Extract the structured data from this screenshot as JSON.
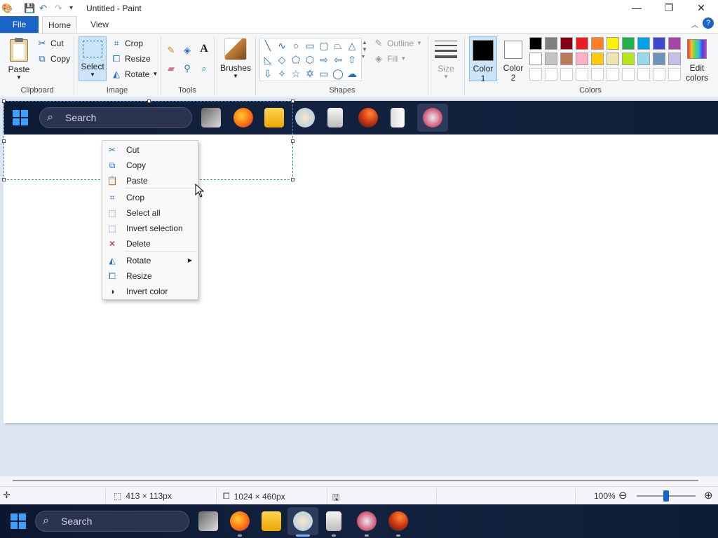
{
  "window": {
    "title": "Untitled - Paint",
    "minimize_glyph": "—",
    "maximize_glyph": "❐",
    "close_glyph": "✕"
  },
  "tabs": {
    "file": "File",
    "home": "Home",
    "view": "View",
    "help_glyph": "?",
    "collapse_glyph": "︿"
  },
  "ribbon": {
    "clipboard": {
      "label": "Clipboard",
      "paste": "Paste",
      "cut": "Cut",
      "copy": "Copy"
    },
    "image": {
      "label": "Image",
      "select": "Select",
      "crop": "Crop",
      "resize": "Resize",
      "rotate": "Rotate"
    },
    "tools": {
      "label": "Tools",
      "text_glyph": "A"
    },
    "brushes": {
      "label": "Brushes"
    },
    "shapes": {
      "label": "Shapes",
      "outline": "Outline",
      "fill": "Fill"
    },
    "size": {
      "label": "Size"
    },
    "colors": {
      "label": "Colors",
      "color1": "Color",
      "color1_num": "1",
      "color2": "Color",
      "color2_num": "2",
      "edit": "Edit",
      "edit2": "colors",
      "palette_row1": [
        "#000000",
        "#7f7f7f",
        "#880015",
        "#ed1c24",
        "#ff7f27",
        "#fff200",
        "#22b14c",
        "#00a2e8",
        "#3f48cc",
        "#a349a4"
      ],
      "palette_row2": [
        "#ffffff",
        "#c3c3c3",
        "#b97a57",
        "#ffaec9",
        "#ffc90e",
        "#efe4b0",
        "#b5e61d",
        "#99d9ea",
        "#7092be",
        "#c8bfe7"
      ]
    }
  },
  "pasted_taskbar": {
    "search_placeholder": "Search"
  },
  "context_menu": {
    "items": [
      {
        "label": "Cut",
        "icon": "scissors-icon"
      },
      {
        "label": "Copy",
        "icon": "copy-icon"
      },
      {
        "label": "Paste",
        "icon": "paste-icon"
      },
      {
        "label": "Crop",
        "icon": "crop-icon"
      },
      {
        "label": "Select all",
        "icon": "select-all-icon"
      },
      {
        "label": "Invert selection",
        "icon": "invert-selection-icon"
      },
      {
        "label": "Delete",
        "icon": "delete-icon"
      },
      {
        "label": "Rotate",
        "icon": "rotate-icon"
      },
      {
        "label": "Resize",
        "icon": "resize-icon"
      },
      {
        "label": "Invert color",
        "icon": "invert-color-icon"
      }
    ]
  },
  "status": {
    "selection_size": "413 × 113px",
    "canvas_size": "1024 × 460px",
    "zoom": "100%"
  },
  "taskbar": {
    "search_placeholder": "Search"
  }
}
